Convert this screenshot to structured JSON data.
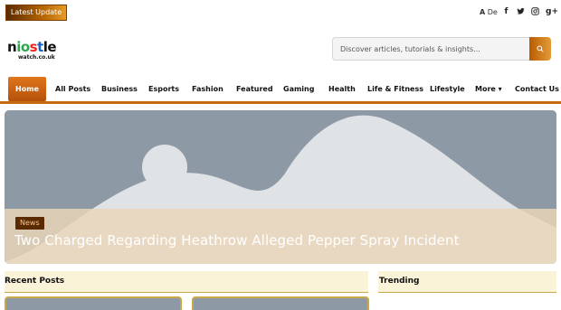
{
  "topbar": {
    "latest_label": "Latest Update",
    "language_label_a": "A",
    "language_label_b": "De",
    "social": [
      {
        "icon": "facebook-icon",
        "glyph": "f"
      },
      {
        "icon": "twitter-icon",
        "glyph": "t"
      },
      {
        "icon": "instagram-icon",
        "glyph": "◎"
      },
      {
        "icon": "google-plus-icon",
        "glyph": "g+"
      }
    ]
  },
  "logo": {
    "word_parts": [
      "n",
      "io",
      "s",
      "t",
      "le"
    ],
    "sub": "watch.co.uk"
  },
  "search": {
    "placeholder": "Discover articles, tutorials & insights..."
  },
  "nav": {
    "items": [
      {
        "label": "Home",
        "active": true
      },
      {
        "label": "All Posts"
      },
      {
        "label": "Business"
      },
      {
        "label": "Esports"
      },
      {
        "label": "Fashion"
      },
      {
        "label": "Featured"
      },
      {
        "label": "Gaming"
      },
      {
        "label": "Health"
      },
      {
        "label": "Life & Fitness"
      },
      {
        "label": "Lifestyle"
      },
      {
        "label": "More ▾"
      },
      {
        "label": "Contact Us"
      }
    ]
  },
  "hero": {
    "badge": "News",
    "title": "Two Charged Regarding Heathrow Alleged Pepper Spray Incident"
  },
  "sections": {
    "recent": "Recent Posts",
    "trending": "Trending"
  },
  "colors": {
    "accent": "#c86a14",
    "placeholder_image": "#8d9aa6"
  }
}
